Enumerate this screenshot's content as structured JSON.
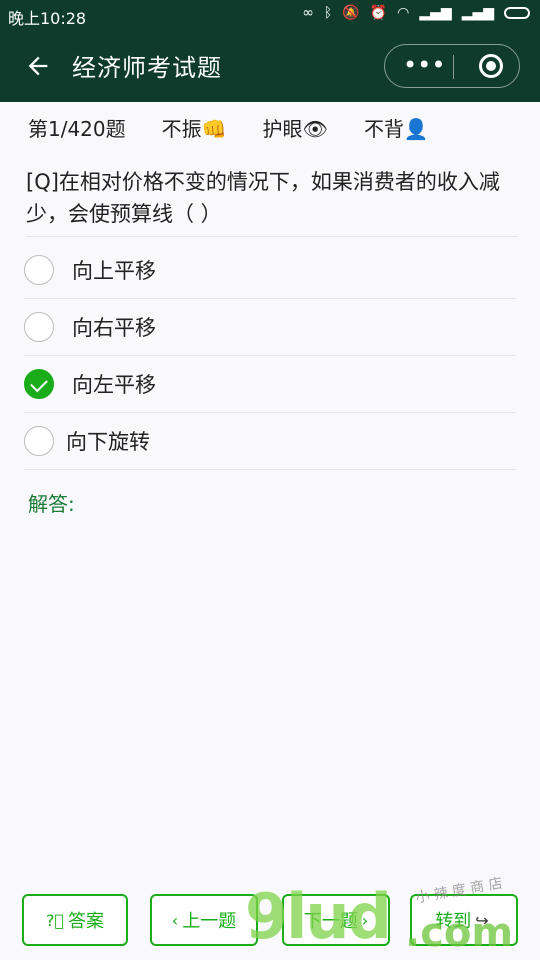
{
  "status": {
    "time": "晚上10:28"
  },
  "appbar": {
    "title": "经济师考试题",
    "more_dots": "•••"
  },
  "info": {
    "progress": "第1/420题",
    "vibrate": "不振👊",
    "eye": "护眼👁",
    "recite": "不背👤"
  },
  "question": {
    "text": "[Q]在相对价格不变的情况下，如果消费者的收入减少，会使预算线（ ）"
  },
  "options": [
    {
      "label": "向上平移",
      "selected": false
    },
    {
      "label": "向右平移",
      "selected": false
    },
    {
      "label": "向左平移",
      "selected": true
    },
    {
      "label": "向下旋转",
      "selected": false
    }
  ],
  "answer_label": "解答:",
  "buttons": {
    "answer": "答案",
    "prev": "上一题",
    "next": "下一题",
    "goto": "转到"
  },
  "watermark": {
    "brand": "9lud",
    "domain": ".com",
    "slogan": "小 辣 度 商 店"
  },
  "colors": {
    "header": "#0e3b2c",
    "accent": "#1aad19"
  }
}
